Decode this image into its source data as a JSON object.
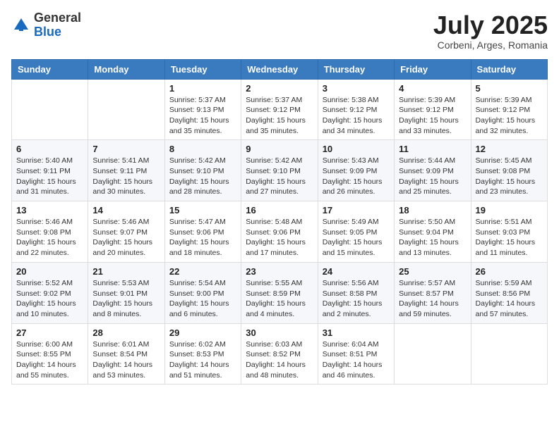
{
  "logo": {
    "general": "General",
    "blue": "Blue"
  },
  "title": "July 2025",
  "subtitle": "Corbeni, Arges, Romania",
  "days_of_week": [
    "Sunday",
    "Monday",
    "Tuesday",
    "Wednesday",
    "Thursday",
    "Friday",
    "Saturday"
  ],
  "weeks": [
    [
      {
        "day": "",
        "info": ""
      },
      {
        "day": "",
        "info": ""
      },
      {
        "day": "1",
        "info": "Sunrise: 5:37 AM\nSunset: 9:13 PM\nDaylight: 15 hours and 35 minutes."
      },
      {
        "day": "2",
        "info": "Sunrise: 5:37 AM\nSunset: 9:12 PM\nDaylight: 15 hours and 35 minutes."
      },
      {
        "day": "3",
        "info": "Sunrise: 5:38 AM\nSunset: 9:12 PM\nDaylight: 15 hours and 34 minutes."
      },
      {
        "day": "4",
        "info": "Sunrise: 5:39 AM\nSunset: 9:12 PM\nDaylight: 15 hours and 33 minutes."
      },
      {
        "day": "5",
        "info": "Sunrise: 5:39 AM\nSunset: 9:12 PM\nDaylight: 15 hours and 32 minutes."
      }
    ],
    [
      {
        "day": "6",
        "info": "Sunrise: 5:40 AM\nSunset: 9:11 PM\nDaylight: 15 hours and 31 minutes."
      },
      {
        "day": "7",
        "info": "Sunrise: 5:41 AM\nSunset: 9:11 PM\nDaylight: 15 hours and 30 minutes."
      },
      {
        "day": "8",
        "info": "Sunrise: 5:42 AM\nSunset: 9:10 PM\nDaylight: 15 hours and 28 minutes."
      },
      {
        "day": "9",
        "info": "Sunrise: 5:42 AM\nSunset: 9:10 PM\nDaylight: 15 hours and 27 minutes."
      },
      {
        "day": "10",
        "info": "Sunrise: 5:43 AM\nSunset: 9:09 PM\nDaylight: 15 hours and 26 minutes."
      },
      {
        "day": "11",
        "info": "Sunrise: 5:44 AM\nSunset: 9:09 PM\nDaylight: 15 hours and 25 minutes."
      },
      {
        "day": "12",
        "info": "Sunrise: 5:45 AM\nSunset: 9:08 PM\nDaylight: 15 hours and 23 minutes."
      }
    ],
    [
      {
        "day": "13",
        "info": "Sunrise: 5:46 AM\nSunset: 9:08 PM\nDaylight: 15 hours and 22 minutes."
      },
      {
        "day": "14",
        "info": "Sunrise: 5:46 AM\nSunset: 9:07 PM\nDaylight: 15 hours and 20 minutes."
      },
      {
        "day": "15",
        "info": "Sunrise: 5:47 AM\nSunset: 9:06 PM\nDaylight: 15 hours and 18 minutes."
      },
      {
        "day": "16",
        "info": "Sunrise: 5:48 AM\nSunset: 9:06 PM\nDaylight: 15 hours and 17 minutes."
      },
      {
        "day": "17",
        "info": "Sunrise: 5:49 AM\nSunset: 9:05 PM\nDaylight: 15 hours and 15 minutes."
      },
      {
        "day": "18",
        "info": "Sunrise: 5:50 AM\nSunset: 9:04 PM\nDaylight: 15 hours and 13 minutes."
      },
      {
        "day": "19",
        "info": "Sunrise: 5:51 AM\nSunset: 9:03 PM\nDaylight: 15 hours and 11 minutes."
      }
    ],
    [
      {
        "day": "20",
        "info": "Sunrise: 5:52 AM\nSunset: 9:02 PM\nDaylight: 15 hours and 10 minutes."
      },
      {
        "day": "21",
        "info": "Sunrise: 5:53 AM\nSunset: 9:01 PM\nDaylight: 15 hours and 8 minutes."
      },
      {
        "day": "22",
        "info": "Sunrise: 5:54 AM\nSunset: 9:00 PM\nDaylight: 15 hours and 6 minutes."
      },
      {
        "day": "23",
        "info": "Sunrise: 5:55 AM\nSunset: 8:59 PM\nDaylight: 15 hours and 4 minutes."
      },
      {
        "day": "24",
        "info": "Sunrise: 5:56 AM\nSunset: 8:58 PM\nDaylight: 15 hours and 2 minutes."
      },
      {
        "day": "25",
        "info": "Sunrise: 5:57 AM\nSunset: 8:57 PM\nDaylight: 14 hours and 59 minutes."
      },
      {
        "day": "26",
        "info": "Sunrise: 5:59 AM\nSunset: 8:56 PM\nDaylight: 14 hours and 57 minutes."
      }
    ],
    [
      {
        "day": "27",
        "info": "Sunrise: 6:00 AM\nSunset: 8:55 PM\nDaylight: 14 hours and 55 minutes."
      },
      {
        "day": "28",
        "info": "Sunrise: 6:01 AM\nSunset: 8:54 PM\nDaylight: 14 hours and 53 minutes."
      },
      {
        "day": "29",
        "info": "Sunrise: 6:02 AM\nSunset: 8:53 PM\nDaylight: 14 hours and 51 minutes."
      },
      {
        "day": "30",
        "info": "Sunrise: 6:03 AM\nSunset: 8:52 PM\nDaylight: 14 hours and 48 minutes."
      },
      {
        "day": "31",
        "info": "Sunrise: 6:04 AM\nSunset: 8:51 PM\nDaylight: 14 hours and 46 minutes."
      },
      {
        "day": "",
        "info": ""
      },
      {
        "day": "",
        "info": ""
      }
    ]
  ]
}
